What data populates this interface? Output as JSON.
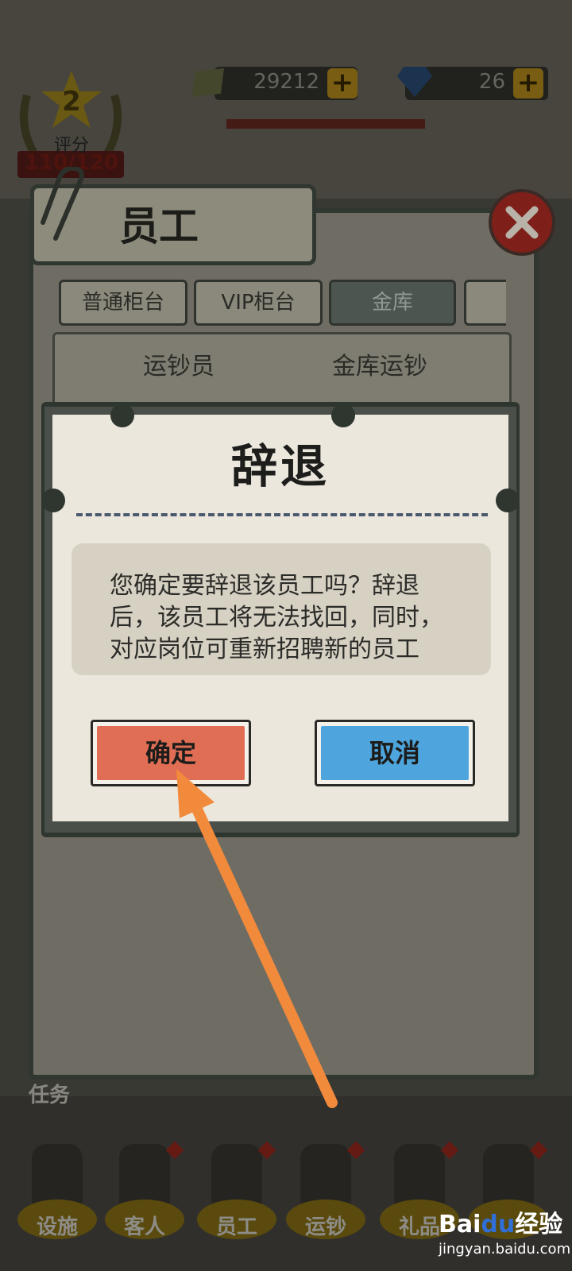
{
  "hud": {
    "rank": "2",
    "rank_label": "评分",
    "rank_score": "110/120",
    "cash_value": "29212",
    "gem_value": "26",
    "plus_label": "+"
  },
  "panel": {
    "title": "员工",
    "tabs": [
      "普通柜台",
      "VIP柜台",
      "金库",
      ""
    ],
    "active_tab": 2,
    "columns": [
      "运钞员",
      "金库运钞"
    ]
  },
  "dialog": {
    "title": "辞退",
    "message_lines": [
      "您确定要辞退该员工吗？辞退",
      "后，该员工将无法找回，同时，",
      "对应岗位可重新招聘新的员工"
    ],
    "confirm_label": "确定",
    "cancel_label": "取消"
  },
  "bottom": {
    "task_label": "任务",
    "nav": [
      "设施",
      "客人",
      "员工",
      "运钞",
      "礼品",
      ""
    ]
  },
  "watermark": {
    "logo_text_a": "Bai",
    "logo_text_b": "du",
    "logo_text_c": "经验",
    "url": "jingyan.baidu.com"
  },
  "colors": {
    "confirm": "#df6e54",
    "cancel": "#4ea5de",
    "arrow": "#f28a3c",
    "close": "#7e2019"
  }
}
